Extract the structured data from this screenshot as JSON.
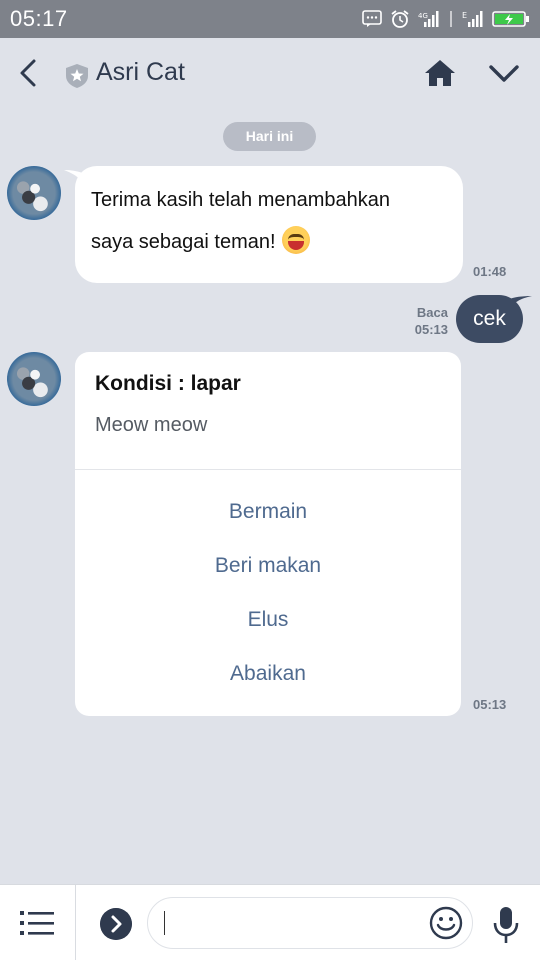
{
  "status_bar": {
    "time": "05:17"
  },
  "header": {
    "title": "Asri Cat"
  },
  "date_chip": "Hari ini",
  "messages": {
    "incoming_1": {
      "line1": "Terima kasih telah menambahkan",
      "line2": "saya sebagai teman!",
      "time": "01:48"
    },
    "outgoing_1": {
      "text": "cek",
      "read_label": "Baca",
      "time": "05:13"
    },
    "card": {
      "title": "Kondisi : lapar",
      "text": "Meow meow",
      "actions": [
        "Bermain",
        "Beri makan",
        "Elus",
        "Abaikan"
      ],
      "time": "05:13"
    }
  },
  "input": {
    "value": ""
  },
  "colors": {
    "header_text": "#2f3a4e",
    "outgoing_bubble": "#3d4b63",
    "action_text": "#4f6a8f",
    "background": "#dfe2e9"
  }
}
